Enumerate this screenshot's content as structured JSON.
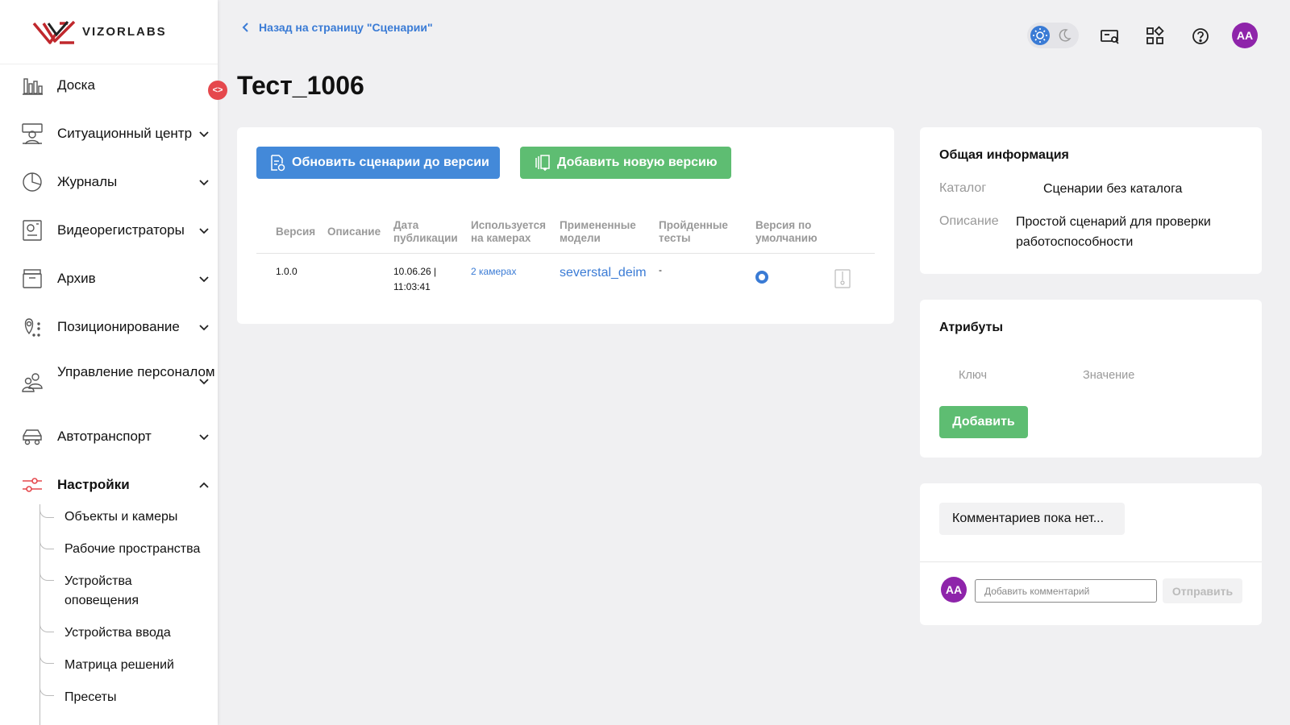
{
  "brand": {
    "logo_text": "VIZORLABS"
  },
  "sidebar": {
    "items": [
      {
        "label": "Доска",
        "icon": "chart-bars-icon"
      },
      {
        "label": "Ситуационный центр",
        "icon": "monitor-person-icon"
      },
      {
        "label": "Журналы",
        "icon": "pie-chart-icon"
      },
      {
        "label": "Видеорегистраторы",
        "icon": "recorder-icon"
      },
      {
        "label": "Архив",
        "icon": "archive-icon"
      },
      {
        "label": "Позиционирование",
        "icon": "location-pin-icon"
      },
      {
        "label": "Управление персоналом",
        "icon": "people-icon"
      },
      {
        "label": "Автотранспорт",
        "icon": "car-icon"
      },
      {
        "label": "Настройки",
        "icon": "sliders-icon",
        "active": true
      }
    ],
    "sub_items": [
      "Объекты и камеры",
      "Рабочие пространства",
      "Устройства оповещения",
      "Устройства ввода",
      "Матрица решений",
      "Пресеты"
    ]
  },
  "header": {
    "back_link": "Назад на страницу \"Сценарии\"",
    "page_title": "Тест_1006",
    "user_initials": "AA"
  },
  "toolbar": {
    "update_button": "Обновить сценарии до версии",
    "add_version_button": "Добавить новую версию"
  },
  "versions_table": {
    "columns": [
      "Версия",
      "Описание",
      "Дата публикации",
      "Используется на камерах",
      "Примененные модели",
      "Пройденные тесты",
      "Версия по умолчанию"
    ],
    "rows": [
      {
        "version": "1.0.0",
        "description": "",
        "date": "10.06.26 |",
        "time": "11:03:41",
        "cameras": "2 камерах",
        "models": "severstal_deim",
        "tests": "-",
        "is_default": true
      }
    ]
  },
  "general_info": {
    "title": "Общая информация",
    "catalog_label": "Каталог",
    "catalog_value": "Сценарии без каталога",
    "description_label": "Описание",
    "description_value": "Простой сценарий для проверки работоспособности"
  },
  "attributes": {
    "title": "Атрибуты",
    "key_label": "Ключ",
    "value_label": "Значение",
    "add_button": "Добавить"
  },
  "comments": {
    "empty_text": "Комментариев пока нет...",
    "input_placeholder": "Добавить комментарий",
    "send_button": "Отправить",
    "user_initials": "AA"
  },
  "colors": {
    "accent_blue": "#4389d9",
    "accent_green": "#5ebd72",
    "avatar_purple": "#8e24aa",
    "brand_red": "#c0282d",
    "collapse_red": "#e5484d"
  }
}
